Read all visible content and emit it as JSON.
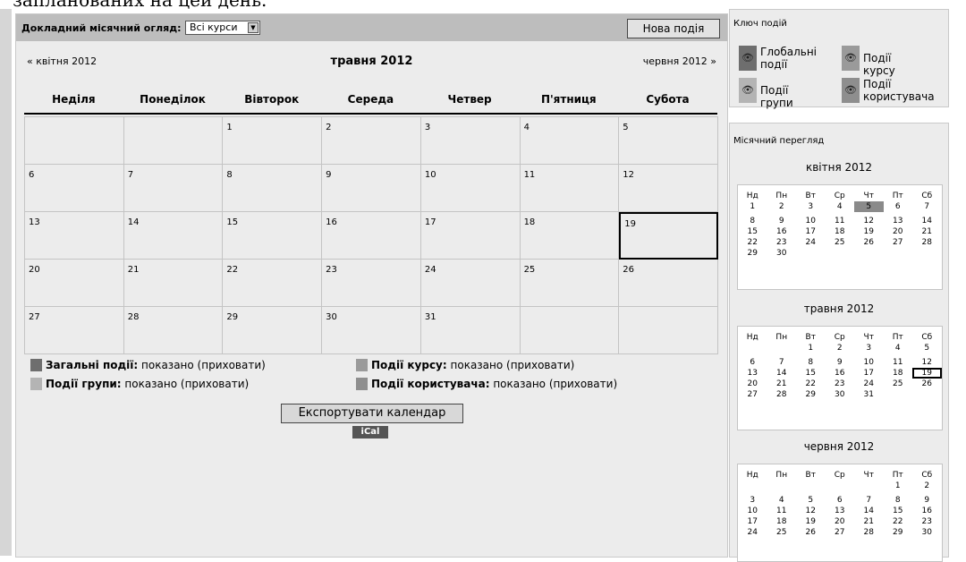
{
  "top_text": "запланованих на цей день.",
  "header": {
    "label": "Докладний місячний огляд:",
    "select_value": "Всі курси",
    "new_event": "Нова подія"
  },
  "nav": {
    "prev": "« квітня 2012",
    "month": "травня 2012",
    "next": "червня 2012 »"
  },
  "weekdays": [
    "Неділя",
    "Понеділок",
    "Вівторок",
    "Середа",
    "Четвер",
    "П'ятниця",
    "Субота"
  ],
  "weeks": [
    [
      "",
      "",
      "1",
      "2",
      "3",
      "4",
      "5"
    ],
    [
      "6",
      "7",
      "8",
      "9",
      "10",
      "11",
      "12"
    ],
    [
      "13",
      "14",
      "15",
      "16",
      "17",
      "18",
      "19"
    ],
    [
      "20",
      "21",
      "22",
      "23",
      "24",
      "25",
      "26"
    ],
    [
      "27",
      "28",
      "29",
      "30",
      "31",
      "",
      ""
    ]
  ],
  "today": "19",
  "legend": {
    "global_label": "Загальні події:",
    "global_state": " показано (приховати)",
    "course_label": "Події курсу:",
    "course_state": " показано (приховати)",
    "group_label": "Події групи:",
    "group_state": " показано (приховати)",
    "user_label": "Події користувача:",
    "user_state": " показано (приховати)"
  },
  "export_button": "Експортувати календар",
  "ical": "iCal",
  "sidebar": {
    "key_title": "Ключ подій",
    "key": {
      "global_1": "Глобальні",
      "global_2": "події",
      "course": "Події курсу",
      "group": "Події групи",
      "user_1": "Події",
      "user_2": "користувача"
    },
    "monthly_title": "Місячний перегляд",
    "mini_headers": [
      "Нд",
      "Пн",
      "Вт",
      "Ср",
      "Чт",
      "Пт",
      "Сб"
    ],
    "april_title": "квітня 2012",
    "may_title": "травня 2012",
    "june_title": "червня 2012"
  },
  "mini_april": [
    [
      "1",
      "2",
      "3",
      "4",
      "5",
      "6",
      "7"
    ],
    [
      "8",
      "9",
      "10",
      "11",
      "12",
      "13",
      "14"
    ],
    [
      "15",
      "16",
      "17",
      "18",
      "19",
      "20",
      "21"
    ],
    [
      "22",
      "23",
      "24",
      "25",
      "26",
      "27",
      "28"
    ],
    [
      "29",
      "30",
      "",
      "",
      "",
      "",
      ""
    ]
  ],
  "mini_may": [
    [
      "",
      "",
      "1",
      "2",
      "3",
      "4",
      "5"
    ],
    [
      "6",
      "7",
      "8",
      "9",
      "10",
      "11",
      "12"
    ],
    [
      "13",
      "14",
      "15",
      "16",
      "17",
      "18",
      "19"
    ],
    [
      "20",
      "21",
      "22",
      "23",
      "24",
      "25",
      "26"
    ],
    [
      "27",
      "28",
      "29",
      "30",
      "31",
      "",
      ""
    ]
  ],
  "mini_june": [
    [
      "",
      "",
      "",
      "",
      "",
      "1",
      "2"
    ],
    [
      "3",
      "4",
      "5",
      "6",
      "7",
      "8",
      "9"
    ],
    [
      "10",
      "11",
      "12",
      "13",
      "14",
      "15",
      "16"
    ],
    [
      "17",
      "18",
      "19",
      "20",
      "21",
      "22",
      "23"
    ],
    [
      "24",
      "25",
      "26",
      "27",
      "28",
      "29",
      "30"
    ]
  ],
  "colors": {
    "global": "#6e6e6e",
    "course": "#9a9a9a",
    "group": "#b4b4b4",
    "user": "#8e8e8e",
    "highlight": "#8a8a8a"
  }
}
